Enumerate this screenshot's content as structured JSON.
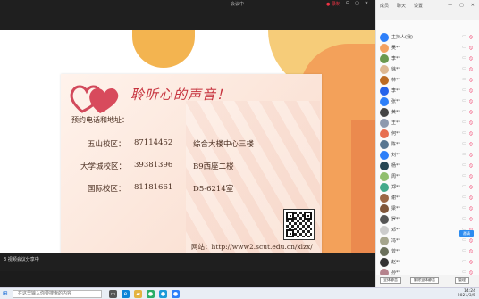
{
  "top": {
    "title": "会议中",
    "controls": [
      "● 录制",
      "⊟",
      "▢",
      "✕"
    ]
  },
  "slide": {
    "title": "聆听心的声音！",
    "subtitle": "预约电话和地址：",
    "rows": [
      {
        "campus": "五山校区：",
        "phone": "87114452",
        "address": "综合大楼中心三楼"
      },
      {
        "campus": "大学城校区：",
        "phone": "39381396",
        "address": "B9西座二楼"
      },
      {
        "campus": "国际校区：",
        "phone": "81181661",
        "address": "D5-6214室"
      }
    ],
    "website": "网站：http://www2.scut.edu.cn/xlzx/"
  },
  "share_bar": {
    "label": "3 视频会议分享中"
  },
  "panel": {
    "tabs": [
      "成员",
      "聊天",
      "设置"
    ],
    "window_controls": [
      "—",
      "▢",
      "✕"
    ],
    "members": [
      {
        "name": "主持人(我)",
        "color": "#2d7ff9"
      },
      {
        "name": "吴**",
        "color": "#f4a261"
      },
      {
        "name": "李**",
        "color": "#6a994e"
      },
      {
        "name": "徐**",
        "color": "#ddb892"
      },
      {
        "name": "林**",
        "color": "#bc6c25"
      },
      {
        "name": "李**",
        "color": "#2563eb"
      },
      {
        "name": "张**",
        "color": "#2d7ff9"
      },
      {
        "name": "黄**",
        "color": "#444444"
      },
      {
        "name": "王**",
        "color": "#8d99ae"
      },
      {
        "name": "何**",
        "color": "#e76f51"
      },
      {
        "name": "陈**",
        "color": "#577590"
      },
      {
        "name": "刘**",
        "color": "#2d7ff9"
      },
      {
        "name": "杨**",
        "color": "#264653"
      },
      {
        "name": "周**",
        "color": "#90be6d"
      },
      {
        "name": "郑**",
        "color": "#43aa8b"
      },
      {
        "name": "谢**",
        "color": "#9c6644"
      },
      {
        "name": "梁**",
        "color": "#7f5539"
      },
      {
        "name": "罗**",
        "color": "#555555"
      },
      {
        "name": "邓**",
        "color": "#cccccc"
      },
      {
        "name": "冯**",
        "color": "#a5a58d"
      },
      {
        "name": "曾**",
        "color": "#6b705c"
      },
      {
        "name": "赵**",
        "color": "#333333"
      },
      {
        "name": "孙**",
        "color": "#b5838d"
      }
    ],
    "invite_button": "邀请",
    "footer_buttons": [
      "全体静音",
      "解除全体静音",
      "管理"
    ]
  },
  "taskbar": {
    "search_placeholder": "在这里输入你要搜索的内容",
    "apps": [
      {
        "icon": "task-view-icon",
        "glyph": "▭",
        "color": "#555555"
      },
      {
        "icon": "edge-icon",
        "glyph": "e",
        "color": "#0b84d8"
      },
      {
        "icon": "folder-icon",
        "glyph": "▰",
        "color": "#e3b341"
      },
      {
        "icon": "wechat-icon",
        "glyph": "●",
        "color": "#2aae67"
      },
      {
        "icon": "qq-icon",
        "glyph": "●",
        "color": "#1c9bd8"
      },
      {
        "icon": "meeting-icon",
        "glyph": "●",
        "color": "#2d7ff9"
      }
    ],
    "time": "14:24",
    "date": "2021/3/5"
  }
}
